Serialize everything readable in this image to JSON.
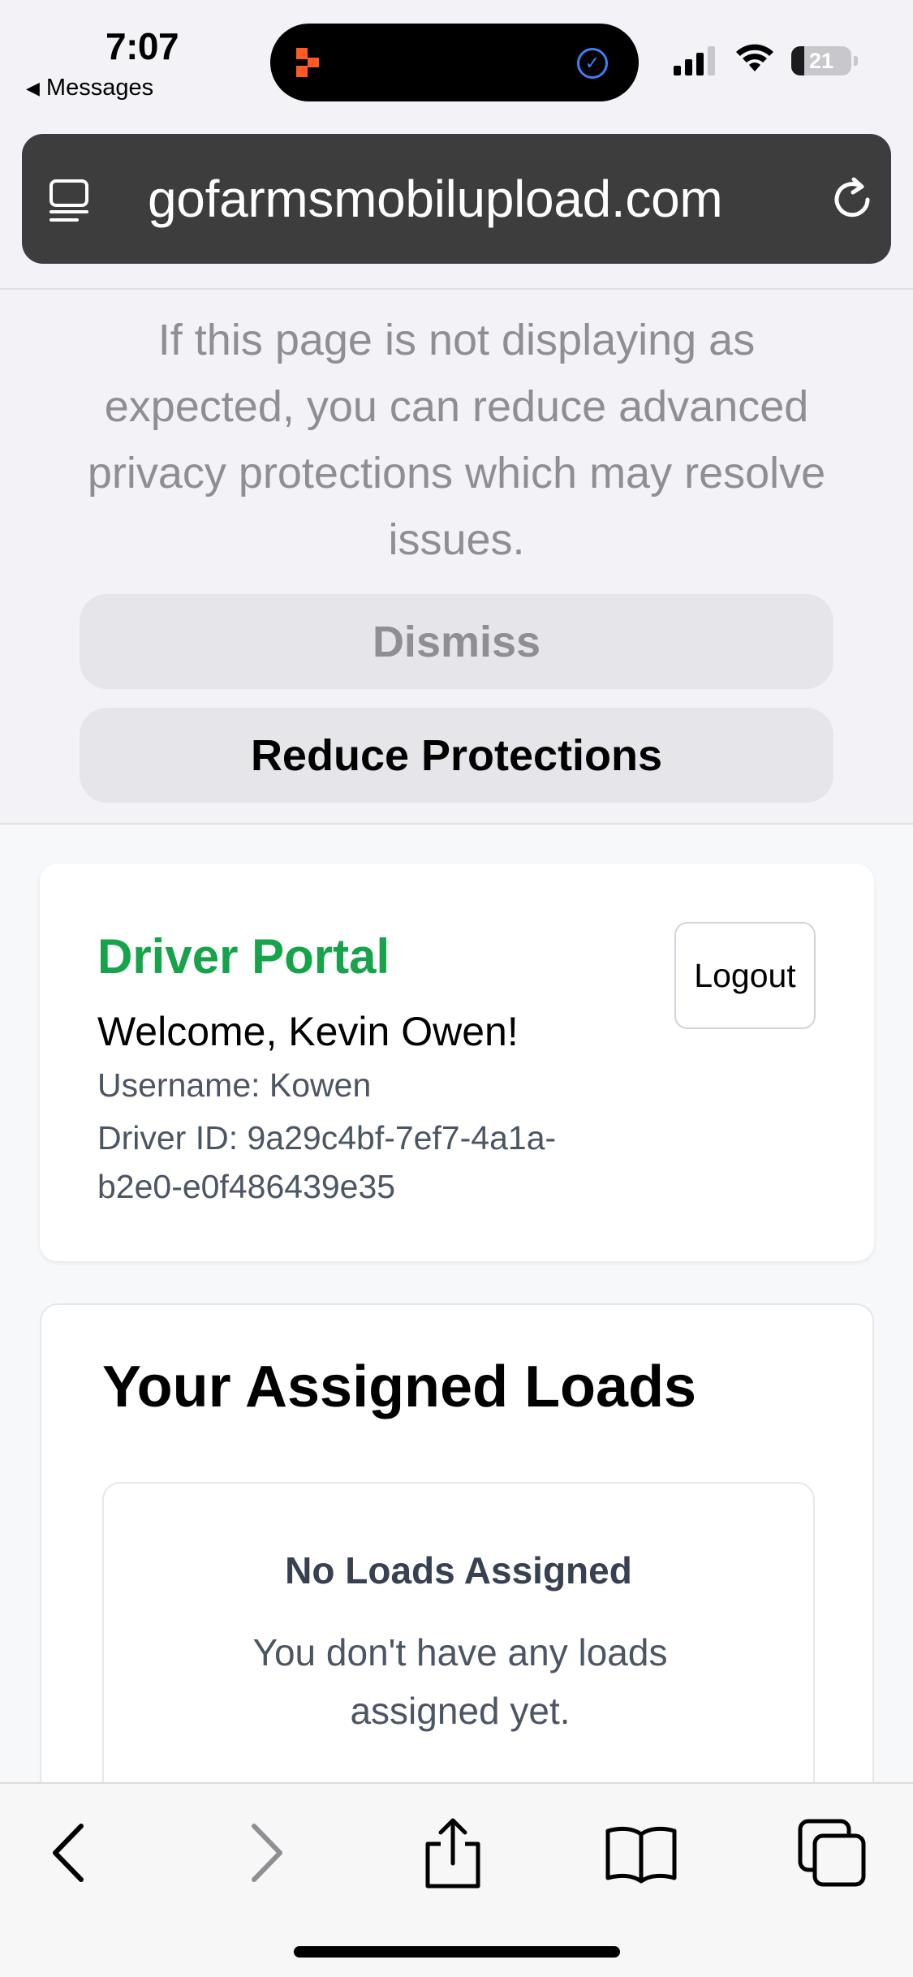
{
  "status_bar": {
    "time": "7:07",
    "back_app": "Messages",
    "battery": "21",
    "battery_level": 0.21
  },
  "browser": {
    "url": "gofarmsmobilupload.com"
  },
  "privacy_notice": {
    "message": "If this page is not displaying as expected, you can reduce advanced privacy protections which may resolve issues.",
    "dismiss_label": "Dismiss",
    "reduce_label": "Reduce Protections"
  },
  "driver_card": {
    "title": "Driver Portal",
    "welcome": "Welcome, Kevin Owen!",
    "username": "Username: Kowen",
    "driver_id": "Driver ID: 9a29c4bf-7ef7-4a1a-b2e0-e0f486439e35",
    "logout_label": "Logout",
    "title_color": "#16a34a"
  },
  "loads_card": {
    "title": "Your Assigned Loads",
    "empty_title": "No Loads Assigned",
    "empty_text": "You don't have any loads assigned yet."
  },
  "toolbar": {
    "icons": [
      "back-icon",
      "forward-icon",
      "share-icon",
      "bookmarks-icon",
      "tabs-icon"
    ]
  }
}
